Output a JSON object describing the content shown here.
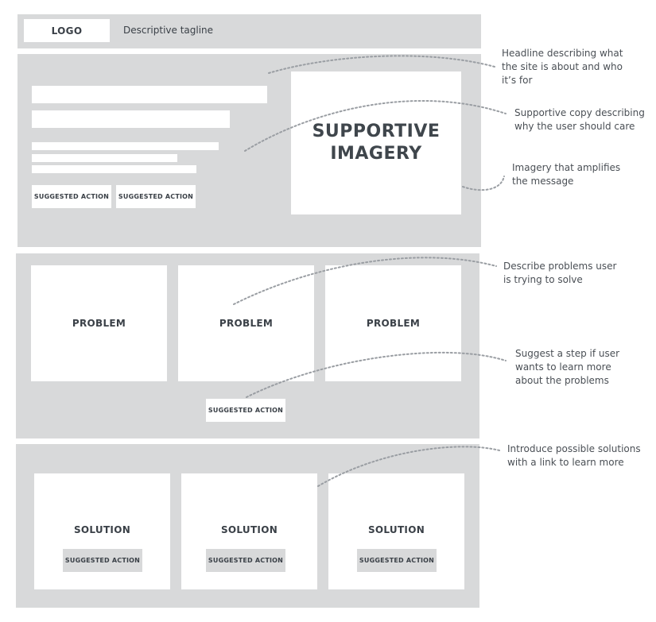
{
  "header": {
    "logo": "LOGO",
    "tagline": "Descriptive tagline"
  },
  "hero": {
    "button_1": "SUGGESTED ACTION",
    "button_2": "SUGGESTED ACTION",
    "imagery": [
      "SUPPORTIVE",
      "IMAGERY"
    ]
  },
  "problems": {
    "cards": [
      "PROBLEM",
      "PROBLEM",
      "PROBLEM"
    ],
    "button": "SUGGESTED ACTION"
  },
  "solutions": {
    "cards": [
      {
        "title": "SOLUTION",
        "button": "SUGGESTED ACTION"
      },
      {
        "title": "SOLUTION",
        "button": "SUGGESTED ACTION"
      },
      {
        "title": "SOLUTION",
        "button": "SUGGESTED ACTION"
      }
    ]
  },
  "annotations": {
    "headline": [
      "Headline describing what",
      "the site is about and who",
      "it’s for"
    ],
    "supportive_copy": [
      "Supportive copy describing",
      "why the user should care"
    ],
    "imagery": [
      "Imagery that amplifies",
      "the message"
    ],
    "problems": [
      "Describe problems user",
      "is trying to solve"
    ],
    "step": [
      "Suggest a step if user",
      "wants to learn more",
      "about the problems"
    ],
    "solutions": [
      "Introduce possible solutions",
      "with a link to learn more"
    ]
  },
  "colors": {
    "panel": "#d8d9da",
    "box": "#ffffff",
    "text": "#3a4047",
    "connector": "#9a9ea3"
  }
}
